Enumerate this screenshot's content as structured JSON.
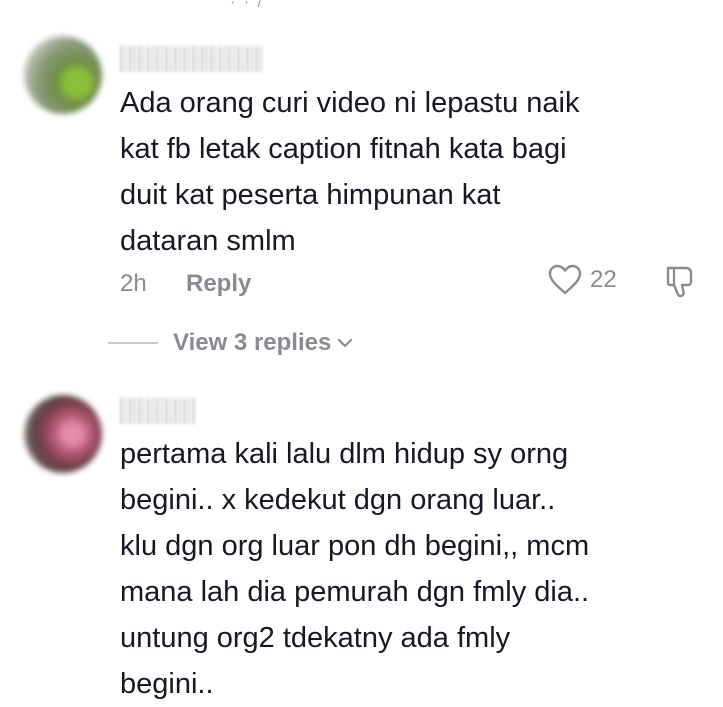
{
  "top_fragment": "· · /",
  "comments": [
    {
      "text": "Ada orang curi video ni lepastu naik\nkat fb letak caption fitnah kata bagi\nduit kat peserta himpunan kat\ndataran smlm",
      "time": "2h",
      "reply_label": "Reply",
      "like_count": "22",
      "view_replies_label": "View 3 replies"
    },
    {
      "text": "pertama kali lalu dlm hidup sy orng\nbegini.. x kedekut dgn orang luar..\nklu dgn org luar pon dh begini,, mcm\nmana lah dia pemurah dgn fmly dia..\nuntung org2 tdekatny ada fmly\nbegini.."
    }
  ],
  "icons": {
    "like": "heart-outline-icon",
    "dislike": "thumbs-down-icon",
    "expand": "chevron-down-icon"
  },
  "colors": {
    "text": "#161823",
    "meta": "#8a8b91"
  }
}
